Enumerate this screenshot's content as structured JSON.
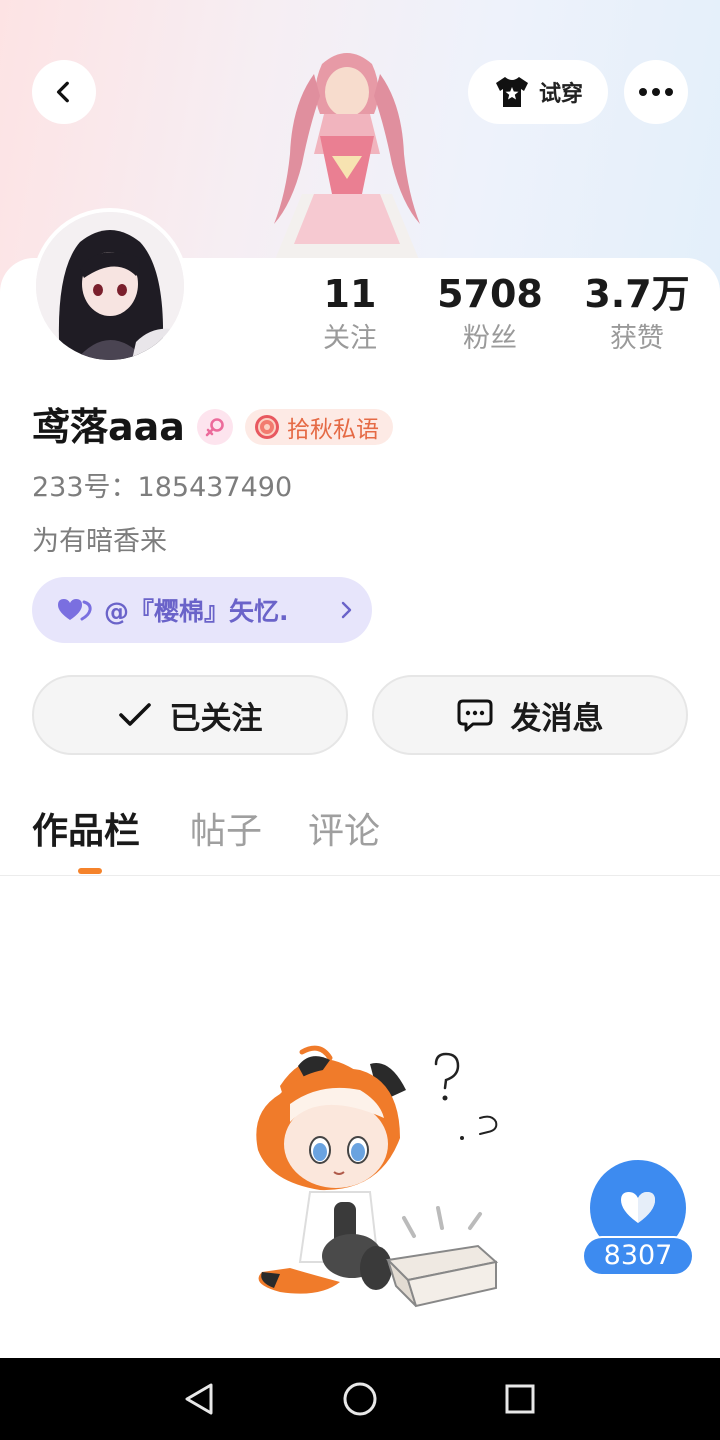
{
  "header": {
    "tryon_label": "试穿"
  },
  "profile": {
    "username": "鸢落aaa",
    "club_badge": "拾秋私语",
    "uid": "233号：185437490",
    "bio": "为有暗香来",
    "cp_link": "@『樱棉』矢忆."
  },
  "stats": {
    "following_value": "11",
    "following_label": "关注",
    "fans_value": "5708",
    "fans_label": "粉丝",
    "likes_value": "3.7万",
    "likes_label": "获赞"
  },
  "actions": {
    "followed_label": "已关注",
    "message_label": "发消息"
  },
  "tabs": [
    {
      "label": "作品栏",
      "active": true
    },
    {
      "label": "帖子",
      "active": false
    },
    {
      "label": "评论",
      "active": false
    }
  ],
  "like_fab": {
    "count": "8307"
  },
  "colors": {
    "accent_orange": "#f5832b",
    "like_blue": "#3d8bf0",
    "cp_purple": "#6a63c9",
    "club_orange": "#e56a45"
  }
}
